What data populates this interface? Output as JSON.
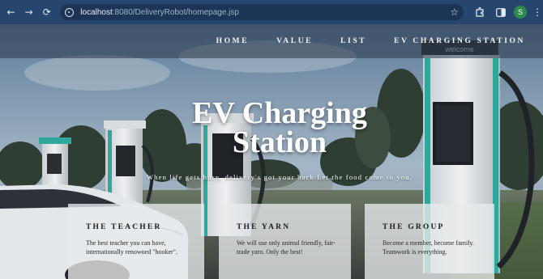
{
  "browser": {
    "url_host": "localhost",
    "url_path": ":8080/DeliveryRobot/homepage.jsp",
    "profile_initial": "S",
    "icons": [
      "back-icon",
      "forward-icon",
      "reload-icon",
      "site-info-icon",
      "star-icon",
      "extensions-icon",
      "sidebar-icon",
      "menu-icon"
    ]
  },
  "nav": {
    "items": [
      {
        "label": "HOME"
      },
      {
        "label": "VALUE"
      },
      {
        "label": "LIST"
      },
      {
        "label": "EV CHARGING STATION"
      }
    ]
  },
  "hero": {
    "title_line1": "EV Charging",
    "title_line2": "Station",
    "tagline": "When life gets busy, delivery's got your back.Let the food come to you."
  },
  "cards": [
    {
      "title": "THE TEACHER",
      "text": "The best teacher you can have, internationally renowned \"hooker\"."
    },
    {
      "title": "THE YARN",
      "text": "We will use only animal friendly, fair-trade yarn. Only the best!"
    },
    {
      "title": "THE GROUP",
      "text": "Become a member, become family. Teamwork is everything."
    }
  ],
  "sign_text": "welcome",
  "colors": {
    "browser_bar": "#27466d",
    "omnibox": "#1c3556",
    "accent_teal": "#2fa79a",
    "card_bg": "#e8eaec"
  }
}
